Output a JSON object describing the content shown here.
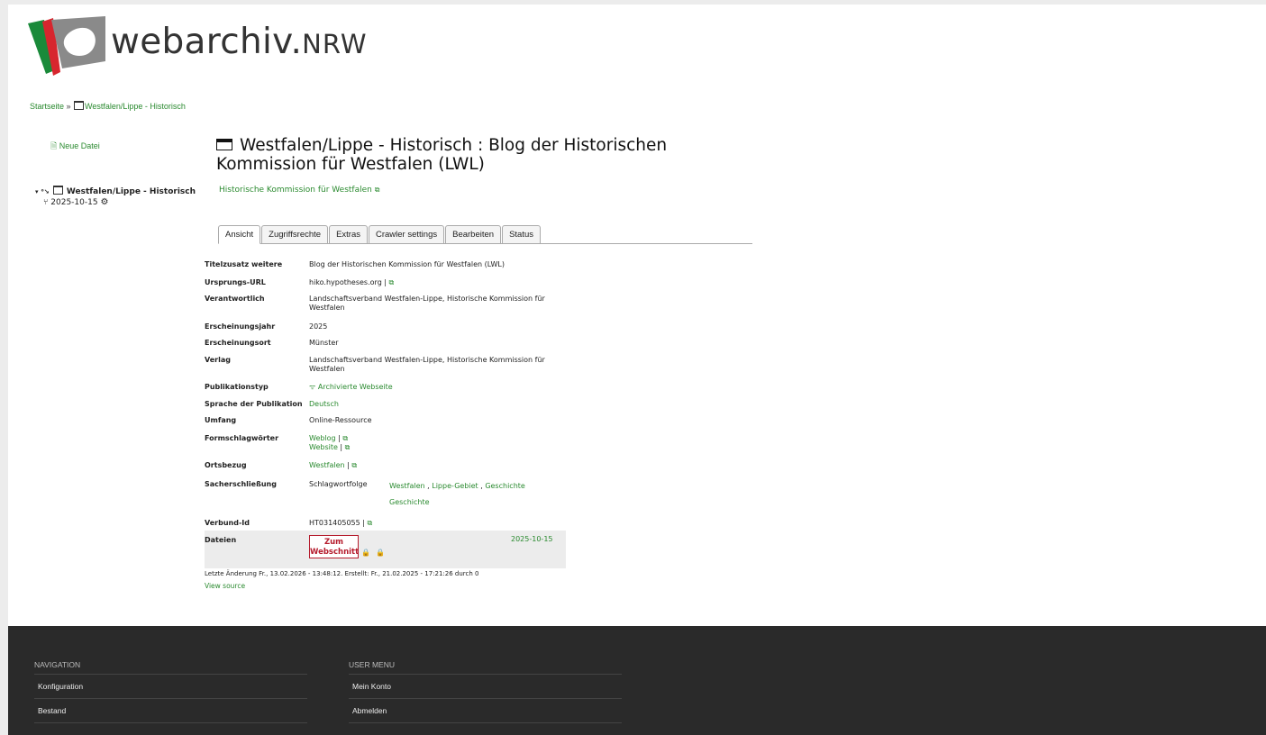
{
  "header": {
    "logo_text_main": "webarchiv.",
    "logo_text_suffix": "NRW"
  },
  "breadcrumb": {
    "home": "Startseite",
    "separator": " » ",
    "current": "Westfalen/Lippe - Historisch"
  },
  "sidebar": {
    "new_file": "Neue Datei",
    "tree_item": "Westfalen/Lippe - Historisch",
    "tree_date": "2025-10-15"
  },
  "main": {
    "title": "Westfalen/Lippe - Historisch : Blog der Historischen Kommission für Westfalen (LWL)",
    "subtitle": "Historische Kommission für Westfalen",
    "tabs": [
      {
        "label": "Ansicht",
        "active": true
      },
      {
        "label": "Zugriffsrechte",
        "active": false
      },
      {
        "label": "Extras",
        "active": false
      },
      {
        "label": "Crawler settings",
        "active": false
      },
      {
        "label": "Bearbeiten",
        "active": false
      },
      {
        "label": "Status",
        "active": false
      }
    ],
    "fields": {
      "titelzusatz": {
        "key": "Titelzusatz weitere",
        "value": "Blog der Historischen Kommission für Westfalen (LWL)"
      },
      "url": {
        "key": "Ursprungs-URL",
        "value": "hiko.hypotheses.org"
      },
      "verantwortlich": {
        "key": "Verantwortlich",
        "value": "Landschaftsverband Westfalen-Lippe, Historische Kommission für Westfalen"
      },
      "jahr": {
        "key": "Erscheinungsjahr",
        "value": "2025"
      },
      "ort": {
        "key": "Erscheinungsort",
        "value": "Münster"
      },
      "verlag": {
        "key": "Verlag",
        "value": "Landschaftsverband Westfalen-Lippe, Historische Kommission für Westfalen"
      },
      "typ": {
        "key": "Publikationstyp",
        "value": "Archivierte Webseite"
      },
      "sprache": {
        "key": "Sprache der Publikation",
        "value": "Deutsch"
      },
      "umfang": {
        "key": "Umfang",
        "value": "Online-Ressource"
      },
      "form": {
        "key": "Formschlagwörter",
        "values": [
          "Weblog",
          "Website"
        ]
      },
      "ortsbezug": {
        "key": "Ortsbezug",
        "value": "Westfalen"
      },
      "sach": {
        "key": "Sacherschließung",
        "sublabel": "Schlagwortfolge",
        "terms": [
          "Westfalen",
          "Lippe-Gebiet",
          "Geschichte"
        ],
        "term2": "Geschichte"
      },
      "verbund": {
        "key": "Verbund-Id",
        "value": "HT031405055"
      },
      "dateien": {
        "key": "Dateien",
        "button_line1": "Zum",
        "button_line2": "Webschnitt",
        "date": "2025-10-15"
      }
    },
    "last_change": "Letzte Änderung Fr., 13.02.2026 - 13:48:12. Erstellt: Fr., 21.02.2025 - 17:21:26 durch 0",
    "view_source": "View source"
  },
  "footer": {
    "navigation": {
      "title": "NAVIGATION",
      "items": [
        "Konfiguration",
        "Bestand"
      ]
    },
    "user_menu": {
      "title": "USER MENU",
      "items": [
        "Mein Konto",
        "Abmelden"
      ]
    }
  },
  "colors": {
    "link": "#2a8a2f",
    "accent_red": "#b51b2c",
    "footer_bg": "#2a2a2a"
  }
}
